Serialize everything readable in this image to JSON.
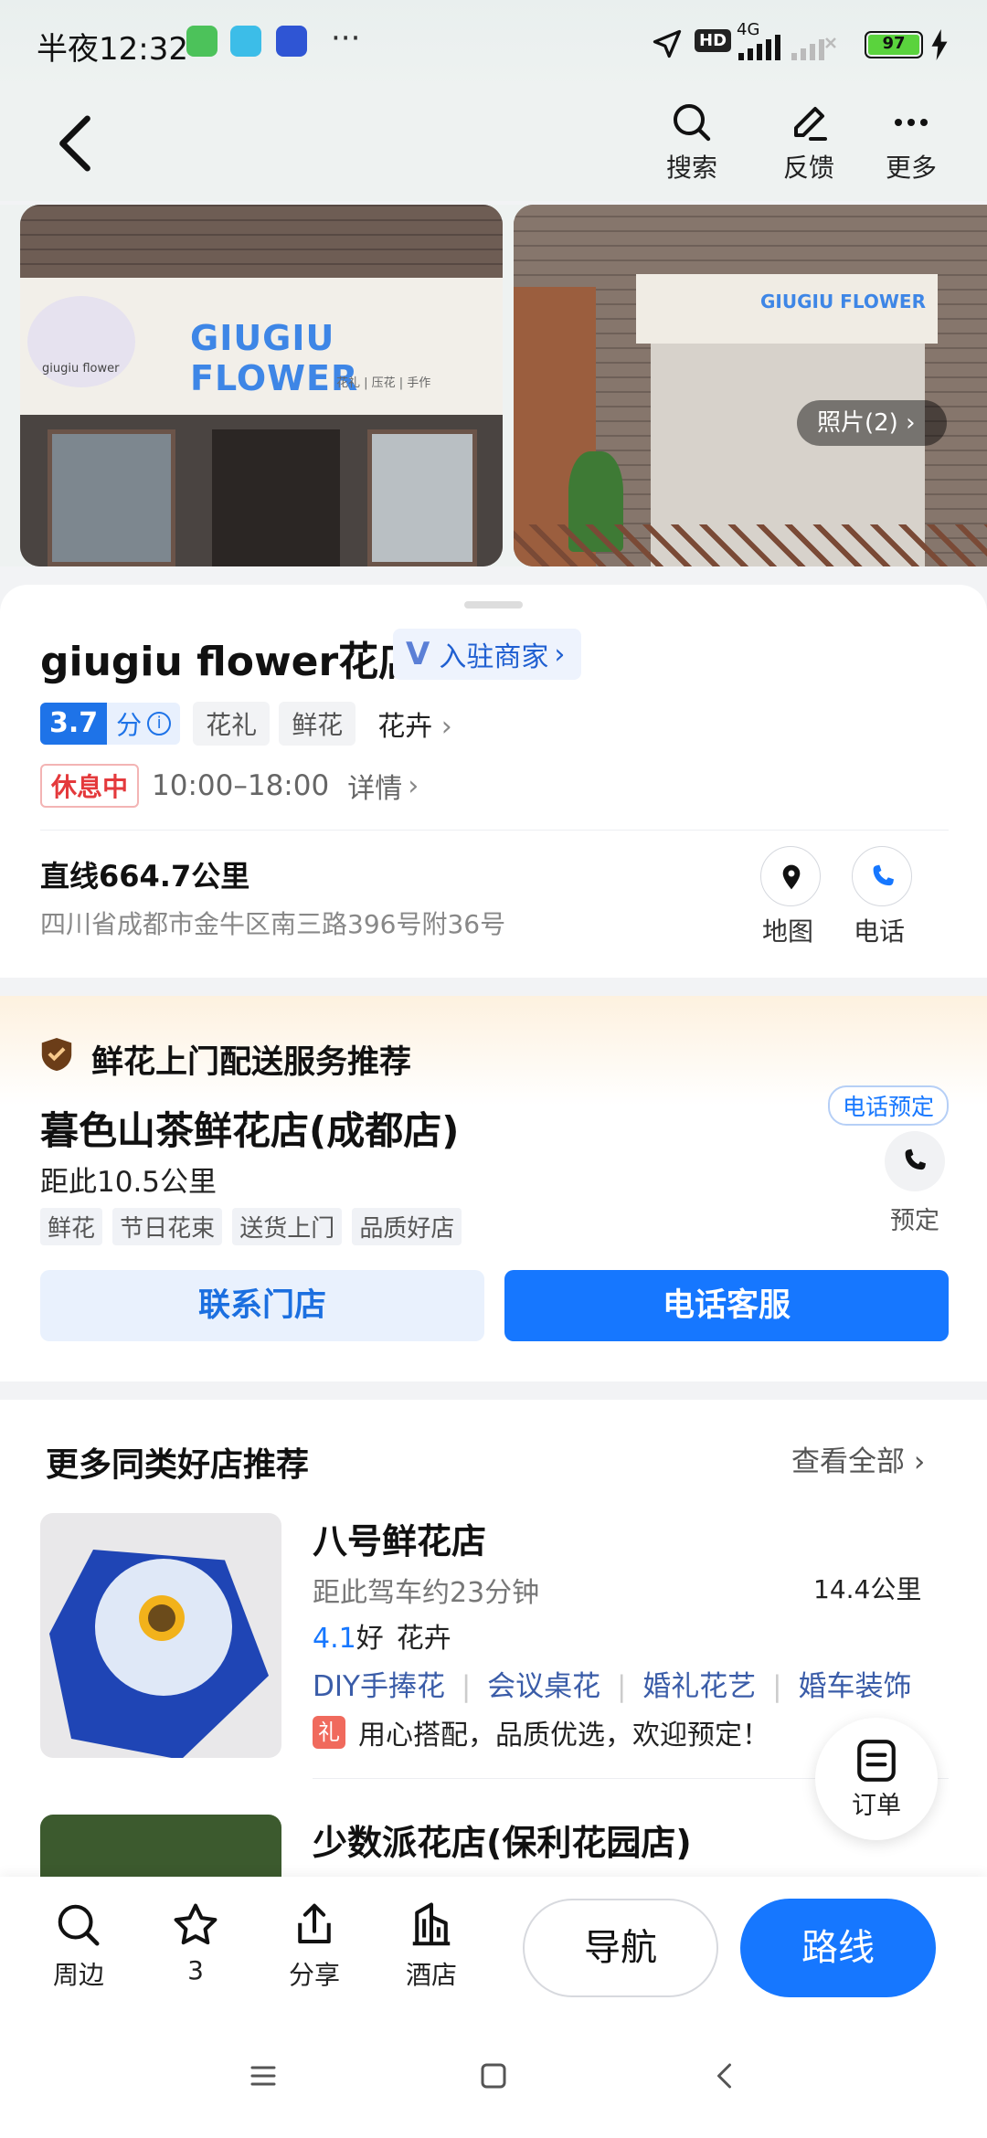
{
  "status": {
    "time": "半夜12:32",
    "more": "···",
    "network": "4G",
    "hd": "HD",
    "battery": "97"
  },
  "nav": {
    "search": "搜索",
    "feedback": "反馈",
    "more": "更多"
  },
  "photos": {
    "sign_text": "GIUGIU FLOWER",
    "sign_sub": "花礼 | 压花 | 手作",
    "logo_text": "giugiu flower",
    "count_label": "照片(2)"
  },
  "poi": {
    "name": "giugiu flower花店",
    "merchant_label": "入驻商家",
    "rating": "3.7",
    "rating_unit": "分",
    "tags": [
      "花礼",
      "鲜花"
    ],
    "category": "花卉",
    "status": "休息中",
    "hours": "10:00–18:00",
    "details": "详情",
    "distance": "直线664.7公里",
    "address": "四川省成都市金牛区南三路396号附36号",
    "map_label": "地图",
    "phone_label": "电话"
  },
  "promo": {
    "header": "鲜花上门配送服务推荐",
    "shop": "暮色山茶鲜花店(成都店)",
    "distance": "距此10.5公里",
    "tags": [
      "鲜花",
      "节日花束",
      "送货上门",
      "品质好店"
    ],
    "phone_book_badge": "电话预定",
    "book_label": "预定",
    "contact_button": "联系门店",
    "service_button": "电话客服"
  },
  "recommend": {
    "title": "更多同类好店推荐",
    "view_all": "查看全部",
    "items": [
      {
        "name": "八号鲜花店",
        "drive": "距此驾车约23分钟",
        "distance": "14.4公里",
        "rating": "4.1",
        "rating_word": "好",
        "category": "花卉",
        "tags": [
          "DIY手捧花",
          "会议桌花",
          "婚礼花艺",
          "婚车装饰"
        ],
        "gift_icon": "礼",
        "promo": "用心搭配，品质优选，欢迎预定！"
      },
      {
        "name": "少数派花店(保利花园店)"
      }
    ],
    "order_label": "订单"
  },
  "bottom": {
    "nearby": "周边",
    "favorite_count": "3",
    "share": "分享",
    "hotel": "酒店",
    "navigate": "导航",
    "route": "路线"
  },
  "colors": {
    "accent": "#1677ff",
    "status_red": "#e4393c",
    "promo_bg": "#fdf3e4"
  }
}
